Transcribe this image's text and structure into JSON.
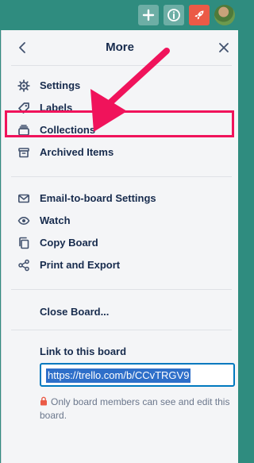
{
  "header": {
    "title": "More"
  },
  "menu": {
    "items": [
      {
        "label": "Settings",
        "icon": "gear-icon"
      },
      {
        "label": "Labels",
        "icon": "tag-icon"
      },
      {
        "label": "Collections",
        "icon": "stack-icon"
      },
      {
        "label": "Archived Items",
        "icon": "archive-icon"
      },
      {
        "label": "Email-to-board Settings",
        "icon": "mail-icon"
      },
      {
        "label": "Watch",
        "icon": "eye-icon"
      },
      {
        "label": "Copy Board",
        "icon": "copy-icon"
      },
      {
        "label": "Print and Export",
        "icon": "share-icon"
      }
    ],
    "close_board": "Close Board..."
  },
  "link": {
    "label": "Link to this board",
    "url": "https://trello.com/b/CCvTRGV9",
    "note": "Only board members can see and edit this board."
  },
  "colors": {
    "board_bg": "#2f8c7f",
    "highlight": "#f0135b",
    "link_selection": "#2e6fc9",
    "rocket_button": "#eb5a46"
  }
}
